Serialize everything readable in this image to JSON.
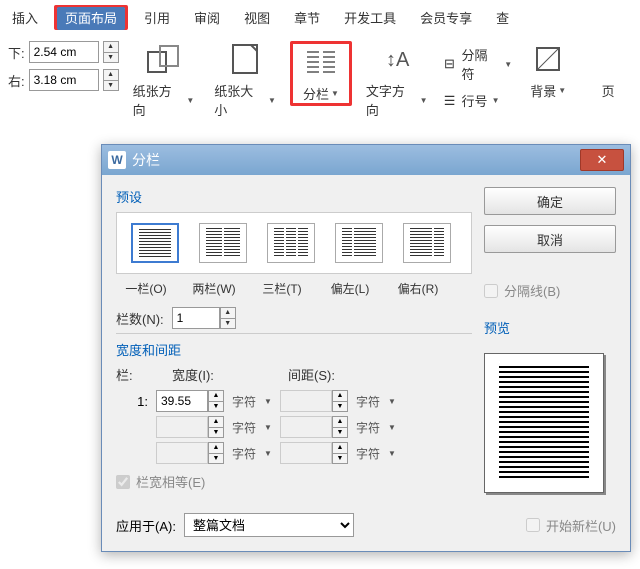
{
  "tabs": {
    "insert": "插入",
    "pageLayout": "页面布局",
    "reference": "引用",
    "review": "审阅",
    "view": "视图",
    "chapter": "章节",
    "devtools": "开发工具",
    "vip": "会员专享",
    "findReplace": "查"
  },
  "margins": {
    "topLabel": "下:",
    "topValue": "2.54 cm",
    "rightLabel": "右:",
    "rightValue": "3.18 cm"
  },
  "ribbon": {
    "orientation": "纸张方向",
    "size": "纸张大小",
    "columns": "分栏",
    "textDir": "文字方向",
    "breaks": "分隔符",
    "lineNum": "行号",
    "background": "背景",
    "pageEdge": "页"
  },
  "dialog": {
    "title": "分栏",
    "presetLabel": "预设",
    "presets": {
      "one": "一栏(O)",
      "two": "两栏(W)",
      "three": "三栏(T)",
      "left": "偏左(L)",
      "right": "偏右(R)"
    },
    "colCountLabel": "栏数(N):",
    "colCountValue": "1",
    "separatorLabel": "分隔线(B)",
    "widthDistLabel": "宽度和间距",
    "colHdr": "栏:",
    "widthHdr": "宽度(I):",
    "spacingHdr": "间距(S):",
    "row1idx": "1:",
    "row1width": "39.55",
    "unit": "字符",
    "equalWidth": "栏宽相等(E)",
    "previewLabel": "预览",
    "applyLabel": "应用于(A):",
    "applyValue": "整篇文档",
    "newColLabel": "开始新栏(U)",
    "ok": "确定",
    "cancel": "取消"
  }
}
